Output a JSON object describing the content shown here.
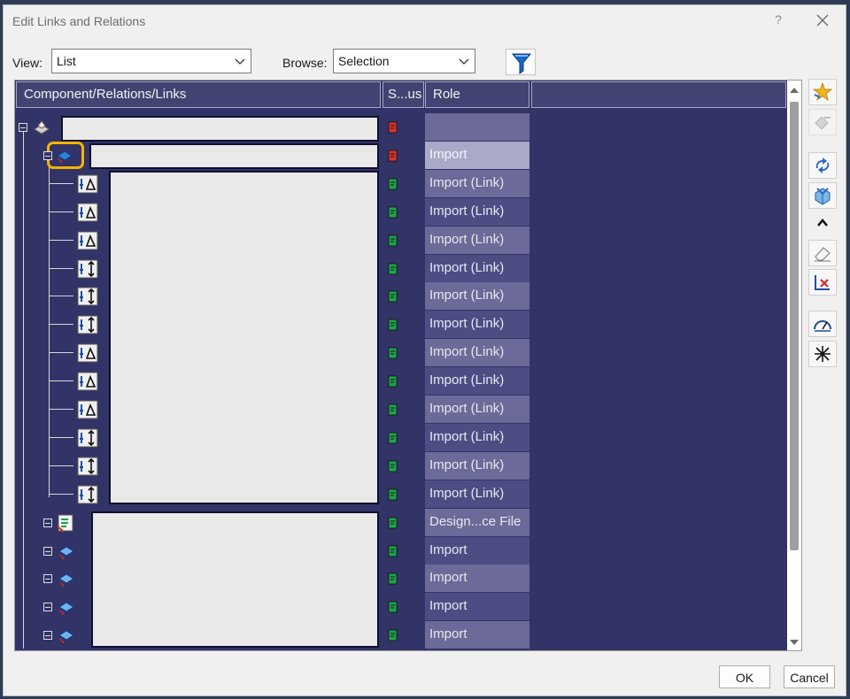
{
  "window": {
    "title": "Edit Links and Relations",
    "help": "?"
  },
  "controls": {
    "view_label": "View:",
    "view_value": "List",
    "browse_label": "Browse:",
    "browse_value": "Selection"
  },
  "columns": {
    "component": "Component/Relations/Links",
    "status": "S...us",
    "role": "Role"
  },
  "rows": [
    {
      "role": "",
      "status": "red"
    },
    {
      "role": "Import",
      "status": "red"
    },
    {
      "role": "Import (Link)",
      "status": "green"
    },
    {
      "role": "Import (Link)",
      "status": "green"
    },
    {
      "role": "Import (Link)",
      "status": "green"
    },
    {
      "role": "Import (Link)",
      "status": "green"
    },
    {
      "role": "Import (Link)",
      "status": "green"
    },
    {
      "role": "Import (Link)",
      "status": "green"
    },
    {
      "role": "Import (Link)",
      "status": "green"
    },
    {
      "role": "Import (Link)",
      "status": "green"
    },
    {
      "role": "Import (Link)",
      "status": "green"
    },
    {
      "role": "Import (Link)",
      "status": "green"
    },
    {
      "role": "Import (Link)",
      "status": "green"
    },
    {
      "role": "Import (Link)",
      "status": "green"
    },
    {
      "role": "Design...ce File",
      "status": "green"
    },
    {
      "role": "Import",
      "status": "green"
    },
    {
      "role": "Import",
      "status": "green"
    },
    {
      "role": "Import",
      "status": "green"
    },
    {
      "role": "Import",
      "status": "green"
    }
  ],
  "buttons": {
    "ok": "OK",
    "cancel": "Cancel"
  },
  "colors": {
    "tree_bg": "#323366",
    "highlight": "#f5b400",
    "status_red": "#d9342b",
    "status_green": "#1fa34a"
  }
}
